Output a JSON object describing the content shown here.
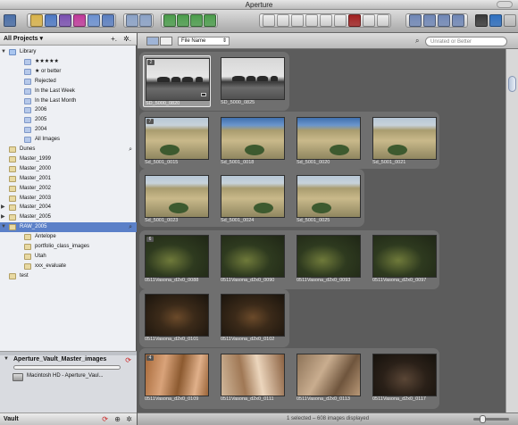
{
  "window": {
    "title": "Aperture"
  },
  "toolbar": {
    "icons": [
      "import-icon",
      "new-project-icon",
      "new-folder-icon",
      "new-album-icon",
      "new-smart-album-icon",
      "new-light-table-icon",
      "new-book-icon",
      "stack-icon",
      "unstack-icon",
      "rotate-left-icon",
      "rotate-right-icon",
      "select-icon",
      "hand-icon",
      "zoom-icon",
      "straighten-icon",
      "crop-icon",
      "lift-icon",
      "redeye-icon",
      "spot-icon",
      "stamp-icon",
      "viewer-mode-icon",
      "full-screen-icon",
      "loupe-icon",
      "inspector-icon",
      "adjustments-icon",
      "metadata-icon"
    ]
  },
  "sidebar": {
    "header": "All Projects",
    "header_arrow": "▾",
    "add_button": "+.",
    "gear_button": "✲.",
    "items": [
      {
        "label": "Library",
        "indent": 1,
        "disclosure": "▼",
        "icon": "lib"
      },
      {
        "label": "★★★★★",
        "indent": 2,
        "icon": "smart"
      },
      {
        "label": "★ or better",
        "indent": 2,
        "icon": "smart"
      },
      {
        "label": "Rejected",
        "indent": 2,
        "icon": "smart"
      },
      {
        "label": "In the Last Week",
        "indent": 2,
        "icon": "smart"
      },
      {
        "label": "In the Last Month",
        "indent": 2,
        "icon": "smart"
      },
      {
        "label": "2006",
        "indent": 2,
        "icon": "smart"
      },
      {
        "label": "2005",
        "indent": 2,
        "icon": "smart"
      },
      {
        "label": "2004",
        "indent": 2,
        "icon": "smart"
      },
      {
        "label": "All Images",
        "indent": 2,
        "icon": "smart"
      },
      {
        "label": "Dunes",
        "indent": 1,
        "icon": "proj",
        "magnifier": true
      },
      {
        "label": "Master_1999",
        "indent": 1,
        "icon": "proj"
      },
      {
        "label": "Master_2000",
        "indent": 1,
        "icon": "proj"
      },
      {
        "label": "Master_2001",
        "indent": 1,
        "icon": "proj"
      },
      {
        "label": "Master_2002",
        "indent": 1,
        "icon": "proj"
      },
      {
        "label": "Master_2003",
        "indent": 1,
        "icon": "proj"
      },
      {
        "label": "Master_2004",
        "indent": 1,
        "disclosure": "▶",
        "icon": "proj"
      },
      {
        "label": "Master_2005",
        "indent": 1,
        "disclosure": "▶",
        "icon": "proj"
      },
      {
        "label": "RAW_2005",
        "indent": 1,
        "disclosure": "▼",
        "icon": "proj",
        "selected": true,
        "magnifier": true
      },
      {
        "label": "Antelope",
        "indent": 2,
        "icon": "proj"
      },
      {
        "label": "portfolio_class_images",
        "indent": 2,
        "icon": "proj"
      },
      {
        "label": "Utah",
        "indent": 2,
        "icon": "proj"
      },
      {
        "label": "xxx_evaluate",
        "indent": 2,
        "icon": "proj"
      },
      {
        "label": "test",
        "indent": 1,
        "icon": "proj"
      }
    ]
  },
  "vault": {
    "name": "Aperture_Vault_Master_images",
    "disclosure": "▼",
    "update_icon": "⟳",
    "progress": 0,
    "drive": "Macintosh HD - Aperture_Vaul...",
    "footer_label": "Vault",
    "footer_icons": [
      "⟳",
      "⊕",
      "✲"
    ]
  },
  "browser": {
    "sort_field": "File Name",
    "sort_arrow": "⇕",
    "search_icon": "⌕",
    "filter_placeholder": "Unrated or Better",
    "status_text": "1 selected – 608 images displayed",
    "stacks": [
      {
        "count": "2",
        "images": [
          {
            "caption": "SD_5000_0820",
            "style": "bw",
            "selected": true
          },
          {
            "caption": "SD_5000_0825",
            "style": "bw"
          }
        ]
      },
      {
        "count": "7",
        "images": [
          {
            "caption": "Sd_5001_0015",
            "style": "dunes"
          },
          {
            "caption": "Sd_5001_0018",
            "style": "dunes2"
          },
          {
            "caption": "Sd_5001_0020",
            "style": "dunes2"
          },
          {
            "caption": "Sd_5001_0021",
            "style": "dunes"
          },
          {
            "caption": "Sd_5001_0023",
            "style": "dunes"
          },
          {
            "caption": "Sd_5001_0024",
            "style": "dunes"
          },
          {
            "caption": "Sd_5001_0025",
            "style": "dunes"
          }
        ]
      },
      {
        "count": "6",
        "images": [
          {
            "caption": "0511Vasona_d2x0_0088",
            "style": "water"
          },
          {
            "caption": "0511Vasona_d2x0_0090",
            "style": "water"
          },
          {
            "caption": "0511Vasona_d2x0_0093",
            "style": "water"
          },
          {
            "caption": "0511Vasona_d2x0_0097",
            "style": "water"
          },
          {
            "caption": "0511Vasona_d2x0_0101",
            "style": "leaf"
          },
          {
            "caption": "0511Vasona_d2x0_0102",
            "style": "leaf"
          }
        ]
      },
      {
        "count": "4",
        "images": [
          {
            "caption": "0511Vasona_d2x0_0109",
            "style": "bark"
          },
          {
            "caption": "0511Vasona_d2x0_0111",
            "style": "bark2"
          },
          {
            "caption": "0511Vasona_d2x0_0113",
            "style": "bark3"
          },
          {
            "caption": "0511Vasona_d2x0_0117",
            "style": "dark"
          }
        ]
      }
    ]
  }
}
